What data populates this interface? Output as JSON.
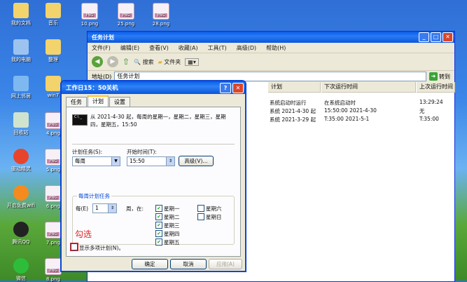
{
  "desktop": {
    "icons": [
      {
        "label": "我的文档"
      },
      {
        "label": "音乐"
      },
      {
        "label": "10.png"
      },
      {
        "label": "25.png"
      },
      {
        "label": "28.png"
      },
      {
        "label": "我的电脑"
      },
      {
        "label": "整理"
      },
      {
        "label": "网上邻居"
      },
      {
        "label": "win7"
      },
      {
        "label": "回收站"
      },
      {
        "label": "4.png"
      },
      {
        "label": "驱动精灵"
      },
      {
        "label": "5.png"
      },
      {
        "label": "开启免费wifi"
      },
      {
        "label": "6.png"
      },
      {
        "label": "腾讯QQ"
      },
      {
        "label": "7.png"
      },
      {
        "label": "微信"
      },
      {
        "label": "8.png"
      }
    ]
  },
  "explorer": {
    "title": "任务计划",
    "menu": [
      "文件(F)",
      "编辑(E)",
      "查看(V)",
      "收藏(A)",
      "工具(T)",
      "高级(D)",
      "帮助(H)"
    ],
    "toolbar": {
      "search": "搜索",
      "folders": "文件夹"
    },
    "address_label": "地址(D)",
    "address_value": "任务计划",
    "go_label": "转到",
    "columns": [
      "计划",
      "下次运行时间",
      "上次运行时间"
    ],
    "rows": [
      [
        "系统启动时运行",
        "在系统启动时",
        "13:29:24"
      ],
      [
        "系统 2021-4-30 起",
        "15:50:00  2021-4-30",
        "无"
      ],
      [
        "系统 2021-3-29 起",
        "T:35:00  2021-5-1",
        "T:35:00"
      ]
    ]
  },
  "dialog": {
    "title": "工作日15：50关机",
    "tabs": [
      "任务",
      "计划",
      "设置"
    ],
    "icon_text": "C:\\ _",
    "summary": "从 2021-4-30 起，每周的星期一，星期二，星期三，星期四，星期五，15:50",
    "schedule_task_label": "计划任务(S):",
    "schedule_task_value": "每周",
    "start_time_label": "开始时间(T):",
    "start_time_value": "15:50",
    "advanced_label": "高级(V)...",
    "weekly_group_title": "每周计划任务",
    "every_label": "每(E)",
    "every_value": "1",
    "weeks_on_label": "周，在:",
    "days": [
      {
        "label": "星期一",
        "checked": true
      },
      {
        "label": "星期二",
        "checked": true
      },
      {
        "label": "星期三",
        "checked": true
      },
      {
        "label": "星期四",
        "checked": true
      },
      {
        "label": "星期五",
        "checked": true
      },
      {
        "label": "星期六",
        "checked": false
      },
      {
        "label": "星期日",
        "checked": false
      }
    ],
    "show_multiple_label": "显示多项计划(N)。",
    "annotation": "勾选",
    "ok_label": "确定",
    "cancel_label": "取消",
    "apply_label": "应用(A)"
  },
  "colors": {
    "accent": "#0a5ae8",
    "annotation": "#e02020"
  }
}
